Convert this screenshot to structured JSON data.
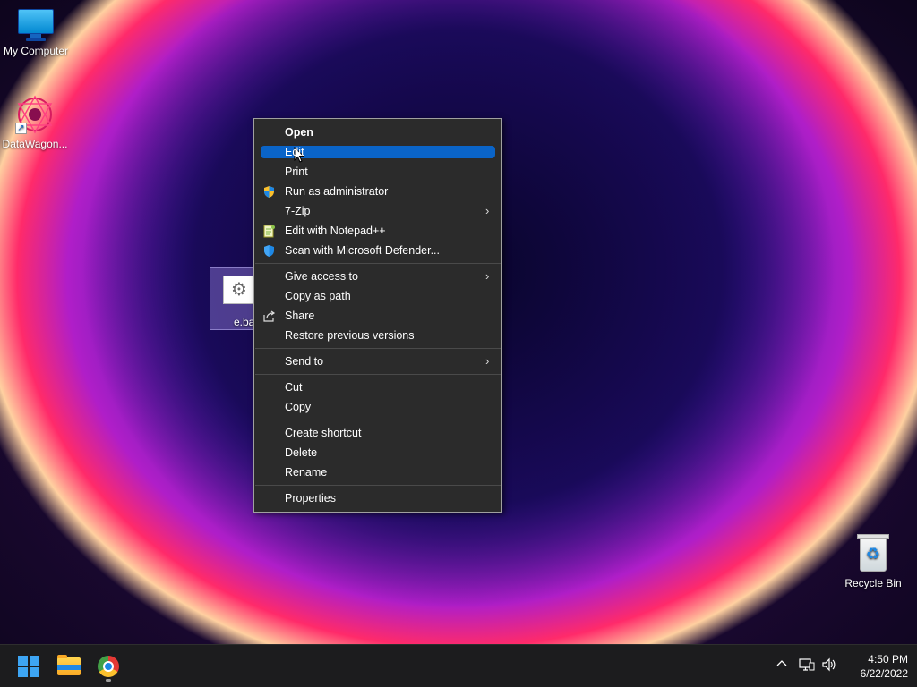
{
  "desktop": {
    "icons": [
      {
        "label": "My Computer"
      },
      {
        "label": "DataWagon..."
      },
      {
        "label": "e.bat"
      },
      {
        "label": "Recycle Bin"
      }
    ]
  },
  "context_menu": {
    "items": {
      "open": "Open",
      "edit": "Edit",
      "print": "Print",
      "run_as_admin": "Run as administrator",
      "seven_zip": "7-Zip",
      "edit_notepadpp": "Edit with Notepad++",
      "scan_defender": "Scan with Microsoft Defender...",
      "give_access": "Give access to",
      "copy_as_path": "Copy as path",
      "share": "Share",
      "restore_versions": "Restore previous versions",
      "send_to": "Send to",
      "cut": "Cut",
      "copy": "Copy",
      "create_shortcut": "Create shortcut",
      "delete": "Delete",
      "rename": "Rename",
      "properties": "Properties"
    },
    "highlighted_item": "Edit"
  },
  "taskbar": {
    "apps": [
      "start-icon",
      "file-explorer-icon",
      "chrome-icon"
    ],
    "tray_icons": [
      "chevron-up-icon",
      "network-icon",
      "volume-icon"
    ],
    "time": "4:50 PM",
    "date": "6/22/2022"
  },
  "colors": {
    "menu_bg": "#2b2b2b",
    "highlight": "#0a64c8",
    "taskbar_bg": "#1c1c1e"
  }
}
